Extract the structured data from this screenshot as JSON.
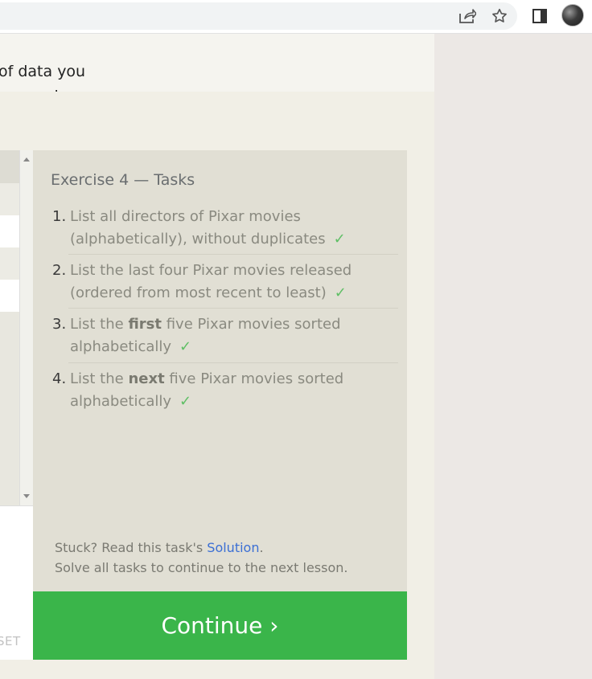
{
  "browser": {
    "icons": [
      "share-icon",
      "star-icon",
      "side-panel-icon",
      "profile-avatar"
    ]
  },
  "lesson": {
    "line1": "of data you",
    "line2": "ur queries."
  },
  "results": {
    "reset_label": "SET"
  },
  "tasks": {
    "title": "Exercise 4 — Tasks",
    "items": [
      {
        "num": "1.",
        "pre": "List all directors of Pixar movies",
        "line2": "(alphabetically), without duplicates",
        "check": "✓"
      },
      {
        "num": "2.",
        "pre": "List the last four Pixar movies released",
        "line2": "(ordered from most recent to least)",
        "check": "✓"
      },
      {
        "num": "3.",
        "pre": "List the ",
        "bold": "first",
        "post": " five Pixar movies sorted",
        "line2": "alphabetically",
        "check": "✓"
      },
      {
        "num": "4.",
        "pre": "List the ",
        "bold": "next",
        "post": " five Pixar movies sorted",
        "line2": "alphabetically",
        "check": "✓"
      }
    ],
    "stuck_prefix": "Stuck? Read this task's ",
    "solution_link": "Solution",
    "stuck_suffix": ".",
    "solve_all": "Solve all tasks to continue to the next lesson."
  },
  "continue_button": "Continue ›"
}
